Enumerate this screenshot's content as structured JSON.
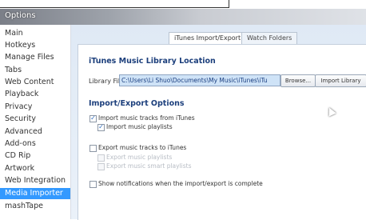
{
  "window": {
    "title": "Options"
  },
  "sidebar": {
    "items": [
      {
        "label": "Main"
      },
      {
        "label": "Hotkeys"
      },
      {
        "label": "Manage Files"
      },
      {
        "label": "Tabs"
      },
      {
        "label": "Web Content"
      },
      {
        "label": "Playback"
      },
      {
        "label": "Privacy"
      },
      {
        "label": "Security"
      },
      {
        "label": "Advanced"
      },
      {
        "label": "Add-ons"
      },
      {
        "label": "CD Rip"
      },
      {
        "label": "Artwork"
      },
      {
        "label": "Web Integration"
      },
      {
        "label": "Media Importer",
        "selected": true
      },
      {
        "label": "mashTape"
      }
    ]
  },
  "tabs": [
    {
      "label": "iTunes Import/Export",
      "active": true
    },
    {
      "label": "Watch Folders",
      "active": false
    }
  ],
  "library": {
    "heading": "iTunes Music Library Location",
    "file_label": "Library File:",
    "path_value": "C:\\Users\\Li Shuo\\Documents\\My Music\\iTunes\\iTu",
    "browse_label": "Browse...",
    "import_label": "Import Library"
  },
  "import_export": {
    "heading": "Import/Export Options",
    "import_tracks": {
      "label": "Import music tracks from iTunes",
      "checked": true
    },
    "import_playlists": {
      "label": "Import music playlists",
      "checked": true
    },
    "export_tracks": {
      "label": "Export music tracks to iTunes",
      "checked": false
    },
    "export_playlists": {
      "label": "Export music playlists",
      "checked": false,
      "disabled": true
    },
    "export_smart": {
      "label": "Export music smart playlists",
      "checked": false,
      "disabled": true
    },
    "show_notifications": {
      "label": "Show notifications when the import/export is complete",
      "checked": false
    }
  },
  "colors": {
    "selection": "#3399ff",
    "heading": "#1c3f7c",
    "panel_bg": "#dfe9f5"
  }
}
